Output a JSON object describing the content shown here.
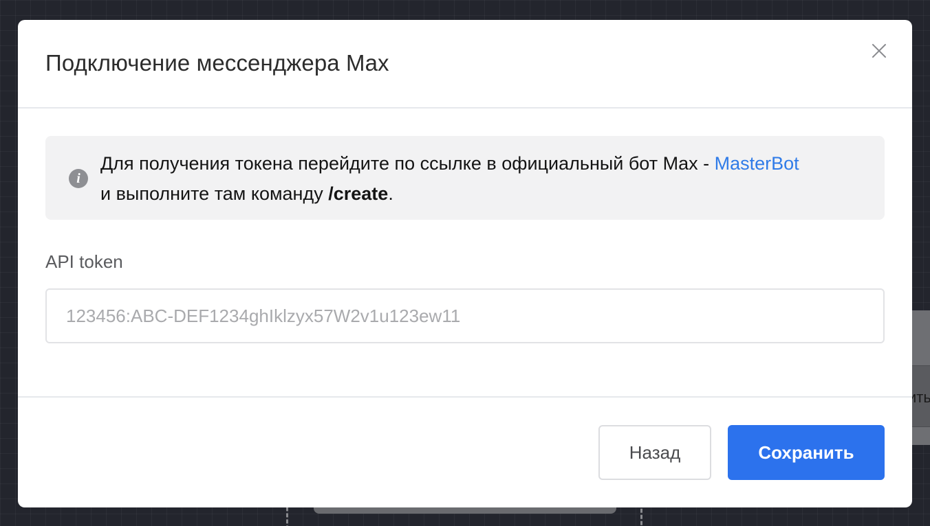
{
  "background": {
    "partial_label": "ить"
  },
  "modal": {
    "title": "Подключение мессенджера Max",
    "close_icon": "close-icon",
    "info": {
      "icon": "info-icon",
      "icon_glyph": "i",
      "text_before_link": "Для получения токена перейдите по ссылке в официальный бот Max - ",
      "link_label": "MasterBot",
      "text_after_link": " и выполните там команду ",
      "command": "/create",
      "text_end": "."
    },
    "field": {
      "label": "API token",
      "value": "",
      "placeholder": "123456:ABC-DEF1234ghIklzyx57W2v1u123ew11"
    },
    "footer": {
      "back_label": "Назад",
      "save_label": "Сохранить"
    }
  },
  "colors": {
    "primary": "#2c72ed",
    "link": "#2f7be8",
    "backdrop": "#23252d",
    "info_bg": "#f2f2f3"
  }
}
